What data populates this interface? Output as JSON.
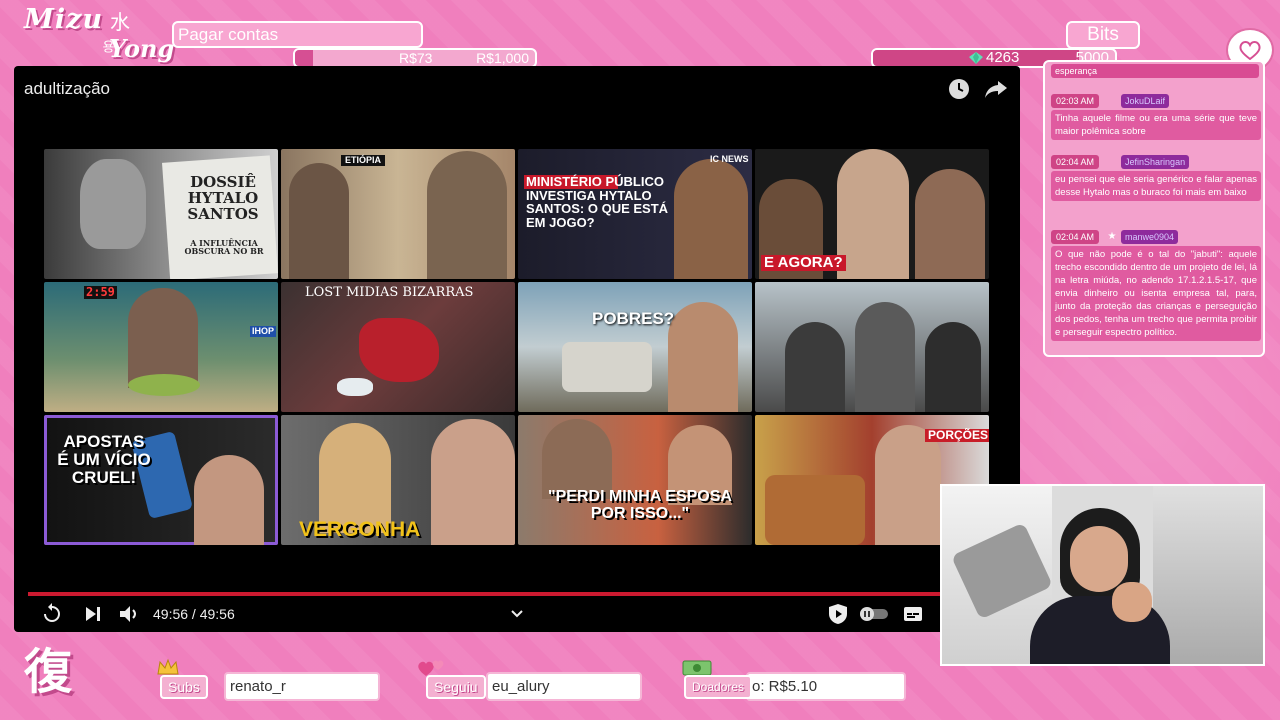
{
  "top": {
    "goal_label": "Pagar contas",
    "goal_current": "R$73",
    "goal_max": "R$1,000",
    "goal_progress": 0.073,
    "bits_label": "Bits",
    "bits_current": "4263",
    "bits_max": "5000",
    "bits_progress": 0.85
  },
  "player": {
    "title": "adultização",
    "time": "49:56 / 49:56",
    "thumbs": [
      {
        "caption": "DOSSIÊ HYTALO SANTOS",
        "sub": "A INFLUÊNCIA OBSCURA NO BR"
      },
      {
        "caption": "ETIÓPIA"
      },
      {
        "caption": "MINISTÉRIO PÚBLICO INVESTIGA HYTALO SANTOS: O QUE ESTÁ EM JOGO?",
        "tag": "IC NEWS"
      },
      {
        "caption": "E AGORA?"
      },
      {
        "caption": "2:59",
        "tag": "IHOP"
      },
      {
        "caption": "LOST MIDIAS BIZARRAS"
      },
      {
        "caption": "POBRES?"
      },
      {
        "caption": ""
      },
      {
        "caption": "APOSTAS É UM VÍCIO CRUEL!"
      },
      {
        "caption": "VERGONHA"
      },
      {
        "caption": "\"PERDI MINHA ESPOSA POR ISSO...\""
      },
      {
        "caption": "PORÇÕES"
      }
    ]
  },
  "chat": {
    "top_text": "esperança",
    "messages": [
      {
        "time": "02:03 AM",
        "user": "JokuDLaif",
        "text": "Tinha aquele filme ou era uma série que teve maior polêmica sobre"
      },
      {
        "time": "02:04 AM",
        "user": "JefinSharingan",
        "text": "eu pensei que ele seria genérico e falar apenas desse Hytalo mas o buraco foi mais em baixo"
      },
      {
        "time": "02:04 AM",
        "user": "manwe0904",
        "text": "O que não pode é o tal do \"jabuti\": aquele trecho escondido dentro de um projeto de lei, lá na letra miúda, no adendo 17.1.2.1.5-17, que envia dinheiro ou isenta empresa tal, para, junto da proteção das crianças e perseguição dos pedos, tenha um trecho que permita proibir e perseguir espectro político."
      }
    ]
  },
  "bottom": {
    "subs_label": "Subs",
    "subs_value": "renato_r",
    "follow_label": "Seguiu",
    "follow_value": "eu_alury",
    "donor_label": "Doadores",
    "donor_value": "o: R$5.10"
  },
  "logo": {
    "line1": "Mizu",
    "line2": "Yong",
    "kanji_top": "水",
    "hangul": "용",
    "kanji_bottom": "復"
  }
}
